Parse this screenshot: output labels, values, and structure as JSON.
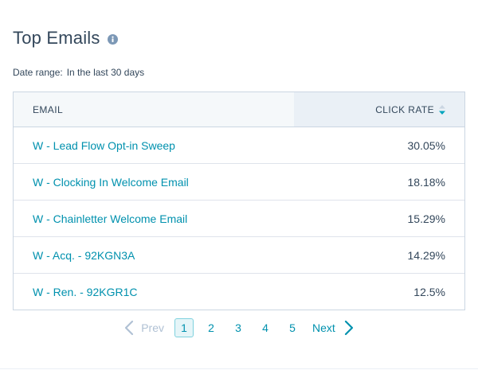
{
  "header": {
    "title": "Top Emails"
  },
  "date_range": {
    "label": "Date range:",
    "value": "In the last 30 days"
  },
  "table": {
    "columns": {
      "email": "EMAIL",
      "click_rate": "CLICK RATE"
    },
    "rows": [
      {
        "email": "W - Lead Flow Opt-in Sweep",
        "click_rate": "30.05%"
      },
      {
        "email": "W - Clocking In Welcome Email",
        "click_rate": "18.18%"
      },
      {
        "email": "W - Chainletter Welcome Email",
        "click_rate": "15.29%"
      },
      {
        "email": "W - Acq. - 92KGN3A",
        "click_rate": "14.29%"
      },
      {
        "email": "W - Ren. - 92KGR1C",
        "click_rate": "12.5%"
      }
    ]
  },
  "pagination": {
    "prev_label": "Prev",
    "next_label": "Next",
    "pages": [
      "1",
      "2",
      "3",
      "4",
      "5"
    ],
    "current_page": "1"
  },
  "colors": {
    "link": "#0091ae",
    "text": "#33475b",
    "header_bg": "#f5f8fa",
    "sorted_header_bg": "#eaf0f6",
    "border": "#cbd6e2",
    "disabled": "#b0c1d4"
  },
  "icons": {
    "info": "info-icon",
    "sort": "sort-descending-icon",
    "prev": "chevron-left-icon",
    "next": "chevron-right-icon"
  }
}
